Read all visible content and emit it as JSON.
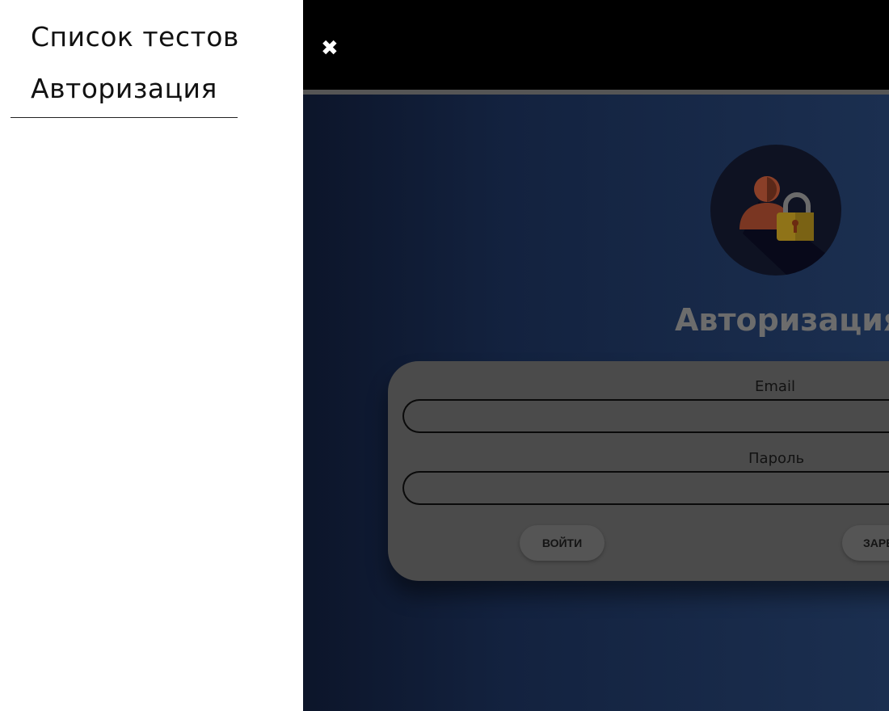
{
  "sidebar": {
    "items": [
      {
        "label": "Список тестов"
      },
      {
        "label": "Авторизация"
      }
    ]
  },
  "header": {
    "close_icon": "close-icon",
    "close_glyph": "✖"
  },
  "auth": {
    "avatar_icon": "user-lock-icon",
    "title": "Авторизация",
    "email_label": "Email",
    "email_value": "",
    "password_label": "Пароль",
    "password_value": "",
    "login_button": "ВОЙТИ",
    "register_button": "ЗАРЕГИСТРИРОВАТЬСЯ"
  },
  "colors": {
    "topbar": "#000000",
    "card": "#4b4b4b",
    "background_from": "#0c152a",
    "background_to": "#1b2f50"
  }
}
